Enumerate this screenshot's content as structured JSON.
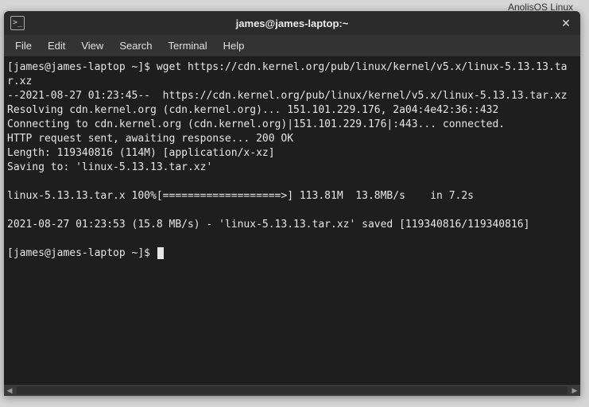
{
  "desktop": {
    "background_hint": "AnolisOS Linux"
  },
  "titlebar": {
    "title": "james@james-laptop:~",
    "icon_glyph": ">_",
    "close_glyph": "✕"
  },
  "menu": {
    "items": [
      "File",
      "Edit",
      "View",
      "Search",
      "Terminal",
      "Help"
    ]
  },
  "terminal": {
    "prompt1": "[james@james-laptop ~]$ ",
    "command1": "wget https://cdn.kernel.org/pub/linux/kernel/v5.x/linux-5.13.13.tar.xz",
    "output": "--2021-08-27 01:23:45--  https://cdn.kernel.org/pub/linux/kernel/v5.x/linux-5.13.13.tar.xz\nResolving cdn.kernel.org (cdn.kernel.org)... 151.101.229.176, 2a04:4e42:36::432\nConnecting to cdn.kernel.org (cdn.kernel.org)|151.101.229.176|:443... connected.\nHTTP request sent, awaiting response... 200 OK\nLength: 119340816 (114M) [application/x-xz]\nSaving to: 'linux-5.13.13.tar.xz'\n\nlinux-5.13.13.tar.x 100%[===================>] 113.81M  13.8MB/s    in 7.2s\n\n2021-08-27 01:23:53 (15.8 MB/s) - 'linux-5.13.13.tar.xz' saved [119340816/119340816]\n",
    "prompt2": "[james@james-laptop ~]$ "
  }
}
